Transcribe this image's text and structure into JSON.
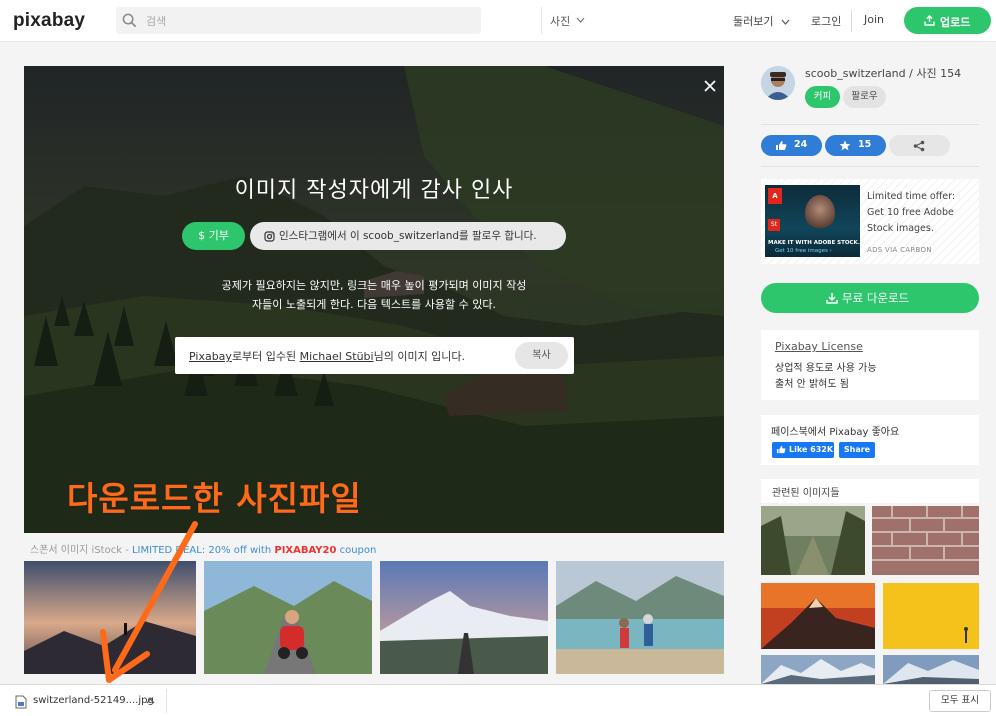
{
  "header": {
    "logo": "pixabay",
    "search_placeholder": "검색",
    "search_type": "사진",
    "explore": "둘러보기",
    "login": "로그인",
    "join": "Join",
    "upload": "업로드"
  },
  "hero": {
    "title": "이미지 작성자에게 감사 인사",
    "donate": "$ 기부",
    "instagram_follow": "인스타그램에서 이 scoob_switzerland를 팔로우 합니다.",
    "description": "공제가 필요하지는 않지만, 링크는 매우 높이 평가되며 이미지 작성자들이 노출되게 한다. 다음 텍스트를 사용할 수 있다.",
    "attribution": {
      "site": "Pixabay",
      "middle": "로부터 입수된 ",
      "author": "Michael Stübi",
      "end": "님의 이미지 입니다."
    },
    "copy": "복사"
  },
  "annotation": {
    "text": "다운로드한 사진파일",
    "color": "#ff6a1a"
  },
  "sponsored": {
    "prefix": "스폰서 이미지 iStock - ",
    "deal": "LIMITED DEAL: 20% off with ",
    "code": "PIXABAY20",
    "suffix": " coupon"
  },
  "sidebar": {
    "username": "scoob_switzerland",
    "photo_count_label": " / 사진 154",
    "coffee": "커피",
    "follow": "팔로우",
    "likes": "24",
    "favorites": "15",
    "ad": {
      "text": "Limited time offer: Get 10 free Adobe Stock images.",
      "via": "ADS VIA CARBON",
      "logo": "A",
      "st": "St",
      "caption": "MAKE IT WITH ADOBE STOCK.",
      "caption2": "Get 10 free images ›"
    },
    "download": "무료 다운로드",
    "license": {
      "title": "Pixabay License",
      "line1": "상업적 용도로 사용 가능",
      "line2": "출처 안 밝혀도 됨"
    },
    "facebook": {
      "title": "페이스북에서 Pixabay 좋아요",
      "like": "Like 632K",
      "share": "Share"
    },
    "related_title": "관련된 이미지들"
  },
  "download_bar": {
    "filename": "switzerland-52149....jpg",
    "show_all": "모두 표시"
  },
  "colors": {
    "accent_green": "#2ec66d",
    "accent_blue": "#2f7dd6",
    "facebook_blue": "#1877f2"
  }
}
